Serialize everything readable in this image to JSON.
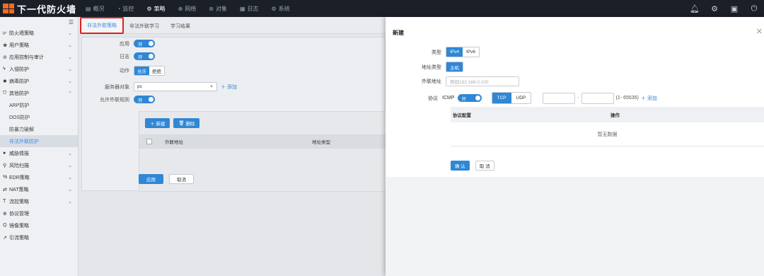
{
  "app": {
    "title": "下一代防火墙"
  },
  "nav": [
    {
      "icon": "▤",
      "label": "概况"
    },
    {
      "icon": "◔",
      "label": "监控"
    },
    {
      "icon": "⚙",
      "label": "策略"
    },
    {
      "icon": "⊕",
      "label": "网络"
    },
    {
      "icon": "⊛",
      "label": "对象"
    },
    {
      "icon": "▦",
      "label": "日志"
    },
    {
      "icon": "⚙",
      "label": "系统"
    }
  ],
  "sidebar": {
    "items": [
      {
        "icon": "⊬",
        "label": "防火墙策略"
      },
      {
        "icon": "♚",
        "label": "用户策略"
      },
      {
        "icon": "⊘",
        "label": "应用控制与审计"
      },
      {
        "icon": "ϟ",
        "label": "入侵防护"
      },
      {
        "icon": "✹",
        "label": "病毒防护"
      },
      {
        "icon": "⛉",
        "label": "其他防护"
      }
    ],
    "subitems": [
      {
        "label": "ARP防护"
      },
      {
        "label": "DOS防护"
      },
      {
        "label": "防暴力破解"
      },
      {
        "label": "非法外联防护"
      }
    ],
    "items2": [
      {
        "icon": "●",
        "label": "威胁情报"
      },
      {
        "icon": "⚲",
        "label": "风险扫描"
      },
      {
        "icon": "%",
        "label": "EDR策略"
      },
      {
        "icon": "⇄",
        "label": "NAT策略"
      },
      {
        "icon": "T",
        "label": "流控策略"
      },
      {
        "icon": "⊕",
        "label": "协议管理"
      },
      {
        "icon": "⛭",
        "label": "镜像策略"
      },
      {
        "icon": "↗",
        "label": "引流策略"
      }
    ]
  },
  "tabs": [
    {
      "label": "非法外联策略"
    },
    {
      "label": "非法外联学习"
    },
    {
      "label": "学习结果"
    }
  ],
  "form": {
    "apply_label": "应用",
    "apply_switch": "开",
    "log_label": "日志",
    "log_switch": "开",
    "action_label": "动作",
    "action_allow": "允许",
    "action_deny": "拒绝",
    "server_label": "服务器对象",
    "server_value": "pc",
    "server_add": "添加",
    "rule_label": "允许外联规则",
    "rule_switch": "开",
    "new_btn": "新建",
    "delete_btn": "删除",
    "col_addr": "外联地址",
    "col_type": "地址类型",
    "apply_btn": "应用",
    "cancel_btn": "取消"
  },
  "drawer": {
    "title": "新建",
    "type_label": "类型",
    "type_ipv4": "IPv4",
    "type_ipv6": "IPv6",
    "addr_type_label": "地址类型",
    "addr_type_value": "主机",
    "outbound_label": "外联地址",
    "outbound_placeholder": "例如192.168.0.100",
    "protocol_label": "协议",
    "icmp_label": "ICMP",
    "icmp_switch": "开",
    "tcp": "TCP",
    "udp": "UDP",
    "port_range_hint": "(1- 65535)",
    "add_link": "添加",
    "col_proto": "协议配置",
    "col_op": "操作",
    "empty_text": "暂无数据",
    "confirm_btn": "确 认",
    "cancel_btn": "取 消"
  }
}
